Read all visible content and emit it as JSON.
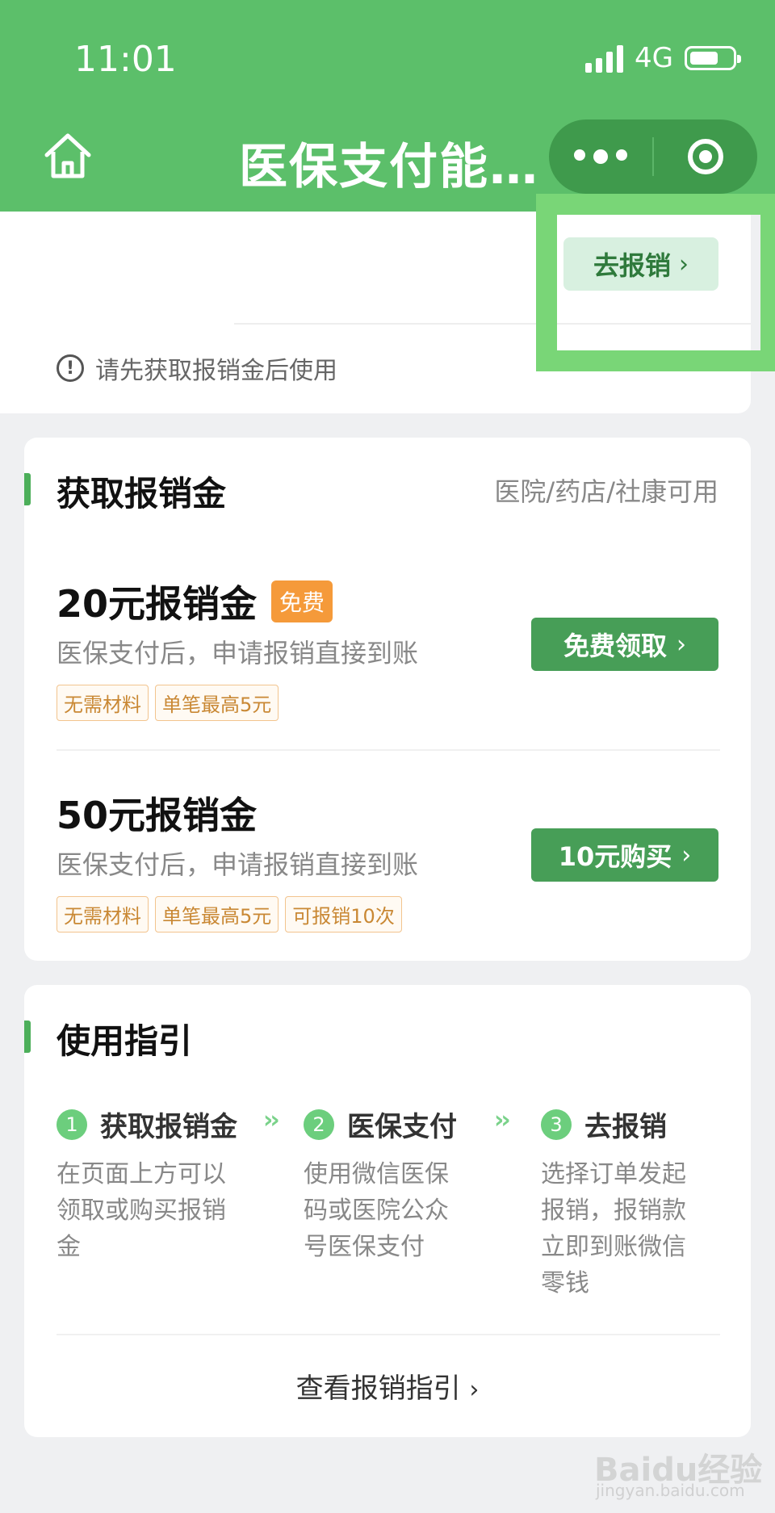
{
  "status_bar": {
    "time": "11:01",
    "network": "4G"
  },
  "header": {
    "title": "医保支付能…",
    "home_icon": "home-icon",
    "more_icon": "more-dots-icon",
    "close_icon": "target-circle-icon",
    "bg_color": "#5cbf6a"
  },
  "top_card": {
    "reimburse_button": "去报销",
    "notice": "请先获取报销金后使用",
    "highlight_color": "#79d677"
  },
  "get_section": {
    "title": "获取报销金",
    "side_note": "医院/药店/社康可用",
    "items": [
      {
        "title": "20元报销金",
        "badge": "免费",
        "desc": "医保支付后，申请报销直接到账",
        "tags": [
          "无需材料",
          "单笔最高5元"
        ],
        "action": "免费领取"
      },
      {
        "title": "50元报销金",
        "desc": "医保支付后，申请报销直接到账",
        "tags": [
          "无需材料",
          "单笔最高5元",
          "可报销10次"
        ],
        "action": "10元购买"
      }
    ]
  },
  "guide_section": {
    "title": "使用指引",
    "steps": [
      {
        "num": "1",
        "title": "获取报销金",
        "desc": "在页面上方可以领取或购买报销金"
      },
      {
        "num": "2",
        "title": "医保支付",
        "desc": "使用微信医保码或医院公众号医保支付"
      },
      {
        "num": "3",
        "title": "去报销",
        "desc": "选择订单发起报销，报销款立即到账微信零钱"
      }
    ],
    "link": "查看报销指引"
  },
  "watermark": {
    "main": "Baidu经验",
    "sub": "jingyan.baidu.com"
  }
}
